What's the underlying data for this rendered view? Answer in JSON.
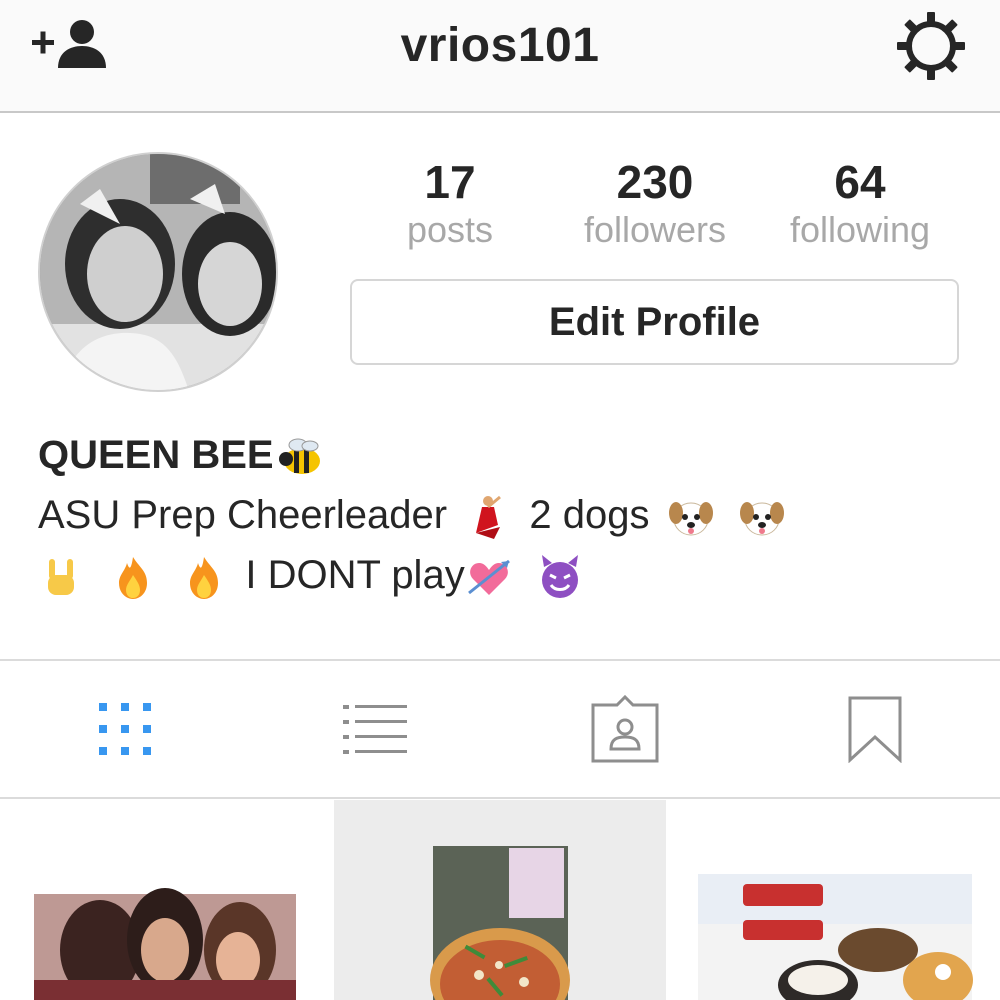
{
  "header": {
    "username": "vrios101",
    "add_user_icon": "add-person-icon",
    "settings_icon": "gear-icon"
  },
  "profile": {
    "stats": [
      {
        "value": "17",
        "label": "posts"
      },
      {
        "value": "230",
        "label": "followers"
      },
      {
        "value": "64",
        "label": "following"
      }
    ],
    "edit_button": "Edit Profile",
    "name": "QUEEN BEE",
    "bio_line1": "ASU Prep Cheerleader",
    "bio_line1b": "2 dogs",
    "bio_line2": "I DONT play"
  },
  "tabs": [
    "grid-view-icon",
    "list-view-icon",
    "tagged-photos-icon",
    "saved-bookmark-icon"
  ],
  "colors": {
    "active_tab": "#3897f0",
    "inactive_tab": "#8e8e8e",
    "secondary_text": "#a8a8a8"
  }
}
